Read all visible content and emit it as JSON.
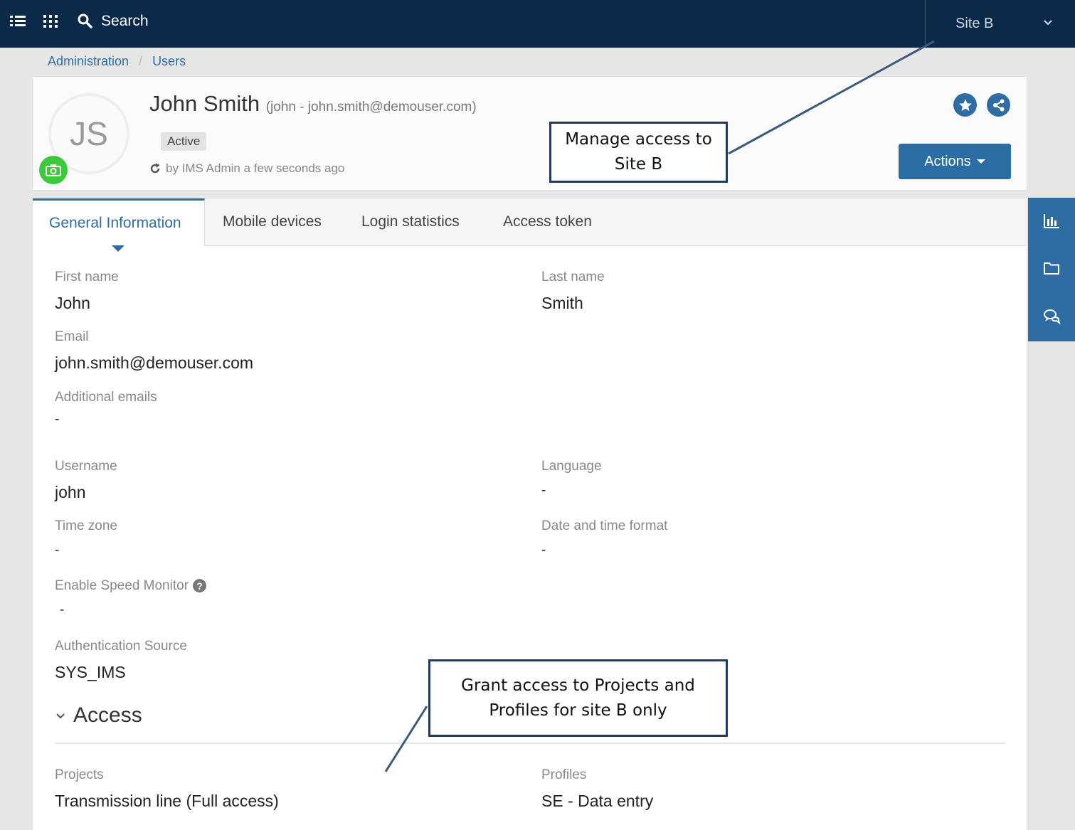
{
  "topbar": {
    "search_label": "Search",
    "site_selector": "Site B",
    "icons": [
      "list-icon",
      "apps-grid-icon",
      "search-icon",
      "chevron-down-icon"
    ]
  },
  "breadcrumb": {
    "items": [
      "Administration",
      "Users"
    ],
    "separator": "/"
  },
  "user": {
    "initials": "JS",
    "full_name": "John Smith",
    "subtitle": "(john - john.smith@demouser.com)",
    "status": "Active",
    "updated": "by IMS Admin a few seconds ago"
  },
  "header_actions": {
    "actions_label": "Actions",
    "icons": [
      "star-icon",
      "share-icon"
    ]
  },
  "tabs": [
    {
      "label": "General Information",
      "active": true
    },
    {
      "label": "Mobile devices"
    },
    {
      "label": "Login statistics"
    },
    {
      "label": "Access token"
    }
  ],
  "fields": {
    "first_name": {
      "label": "First name",
      "value": "John"
    },
    "last_name": {
      "label": "Last name",
      "value": "Smith"
    },
    "email": {
      "label": "Email",
      "value": "john.smith@demouser.com"
    },
    "additional_emails": {
      "label": "Additional emails",
      "value": "-"
    },
    "username": {
      "label": "Username",
      "value": "john"
    },
    "language": {
      "label": "Language",
      "value": "-"
    },
    "time_zone": {
      "label": "Time zone",
      "value": "-"
    },
    "date_time_format": {
      "label": "Date and time format",
      "value": "-"
    },
    "speed_monitor": {
      "label": "Enable Speed Monitor",
      "value": "-"
    },
    "auth_source": {
      "label": "Authentication Source",
      "value": "SYS_IMS"
    }
  },
  "access": {
    "title": "Access",
    "projects": {
      "label": "Projects",
      "value": "Transmission line (Full access)"
    },
    "profiles": {
      "label": "Profiles",
      "value": "SE - Data entry"
    }
  },
  "rightbar": {
    "icons": [
      "bar-chart-icon",
      "folder-icon",
      "chat-icon"
    ]
  },
  "callouts": {
    "manage_access": {
      "line1": "Manage access to",
      "line2": "Site B"
    },
    "grant_access": {
      "line1": "Grant access to Projects and",
      "line2": "Profiles for site B only"
    }
  },
  "colors": {
    "topbar": "#0b2a4a",
    "accent": "#2d6da4",
    "active_tab": "#2e6da4",
    "camera": "#3cc93c",
    "callout_border": "#23395d"
  }
}
